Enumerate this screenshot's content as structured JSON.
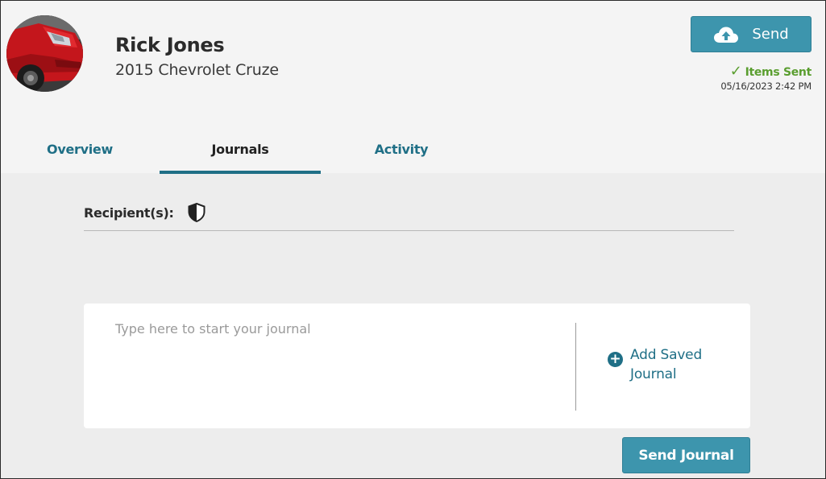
{
  "header": {
    "customer_name": "Rick Jones",
    "vehicle": "2015 Chevrolet Cruze",
    "avatar_icon": "damaged-car-photo",
    "send_label": "Send",
    "send_icon": "cloud-upload-icon",
    "status": {
      "check": "✓",
      "label": "Items Sent",
      "date": "05/16/2023 2:42 PM",
      "color": "#5a9e2f"
    }
  },
  "tabs": [
    {
      "label": "Overview",
      "active": false
    },
    {
      "label": "Journals",
      "active": true
    },
    {
      "label": "Activity",
      "active": false
    }
  ],
  "journals": {
    "recipients_label": "Recipient(s):",
    "recipients_icon": "shield-icon",
    "input_placeholder": "Type here to start your journal",
    "input_value": "",
    "add_saved_icon": "plus-circle-icon",
    "add_saved_label": "Add Saved Journal",
    "send_journal_label": "Send Journal"
  },
  "colors": {
    "accent": "#1f6f86",
    "button": "#3d95ad",
    "background": "#ededed",
    "header_bg": "#f4f4f4"
  }
}
